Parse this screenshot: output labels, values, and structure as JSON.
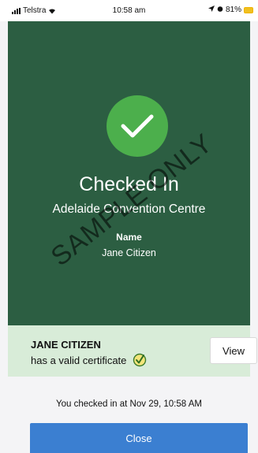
{
  "status_bar": {
    "carrier": "Telstra",
    "time": "10:58 am",
    "battery": "81%"
  },
  "hero": {
    "title": "Checked In",
    "venue": "Adelaide Convention Centre",
    "name_label": "Name",
    "name_value": "Jane Citizen",
    "watermark": "SAMPLE ONLY",
    "background": "#2c5e42",
    "check_color": "#4caf4c"
  },
  "certificate": {
    "holder": "JANE CITIZEN",
    "status_text": "has a valid certificate",
    "view_label": "View",
    "icon": "certificate-tick-icon",
    "background": "#d8ecd8"
  },
  "footer": {
    "checked_in_text": "You checked in at Nov 29, 10:58 AM",
    "close_label": "Close",
    "close_color": "#3b7fd1"
  }
}
